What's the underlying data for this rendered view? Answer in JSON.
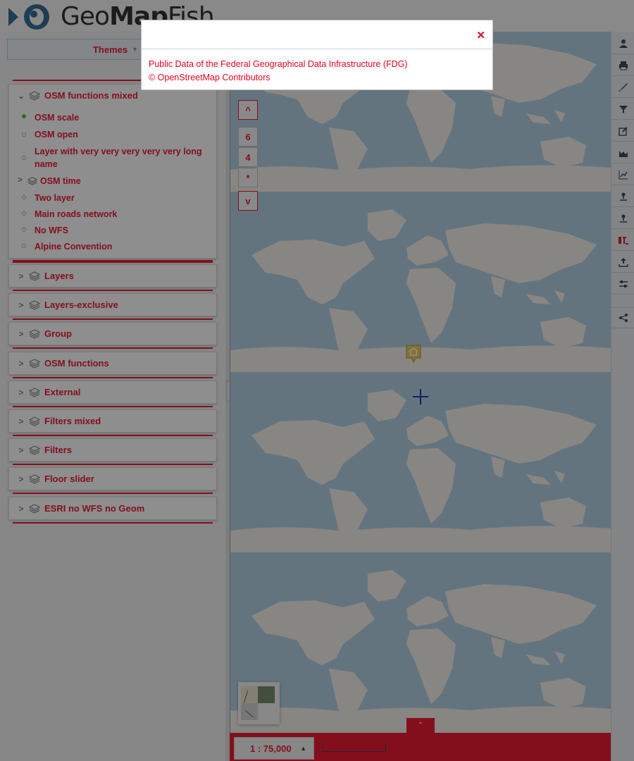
{
  "header": {
    "logo_prefix": "Geo",
    "logo_bold": "Map",
    "logo_suffix": "Fish"
  },
  "left_panel": {
    "themes_label": "Themes",
    "open_group": {
      "title": "OSM functions mixed",
      "items": [
        {
          "label": "OSM scale",
          "active": true
        },
        {
          "label": "OSM open",
          "active": false
        },
        {
          "label": "Layer with very very very very very long name",
          "active": false
        },
        {
          "label": "OSM time",
          "is_group": true
        },
        {
          "label": "Two layer",
          "active": false
        },
        {
          "label": "Main roads network",
          "active": false
        },
        {
          "label": "No WFS",
          "active": false
        },
        {
          "label": "Alpine Convention",
          "active": false
        }
      ]
    },
    "groups": [
      "Layers",
      "Layers-exclusive",
      "Group",
      "OSM functions",
      "External",
      "Filters mixed",
      "Filters",
      "Floor slider",
      "ESRI no WFS no Geom"
    ]
  },
  "map": {
    "nav_up": "^",
    "floors": [
      "6",
      "4",
      "*"
    ],
    "nav_down": "v",
    "scale_label": "1 : 75,000"
  },
  "popup": {
    "lines": [
      "Public Data of the Federal Geographical Data Infrastructure (FDG)",
      "© OpenStreetMap Contributors"
    ]
  },
  "toolbar": {
    "icons": [
      "user-icon",
      "print-icon",
      "draw-icon",
      "filter-icon",
      "edit-icon",
      "profile-icon",
      "chart-icon",
      "routing-icon",
      "routing-2-icon",
      "import-icon",
      "upload-icon",
      "settings-icon",
      "share-icon"
    ]
  },
  "colors": {
    "accent": "#e8001c",
    "ocean": "#aacbe0",
    "land": "#f2efe9"
  }
}
